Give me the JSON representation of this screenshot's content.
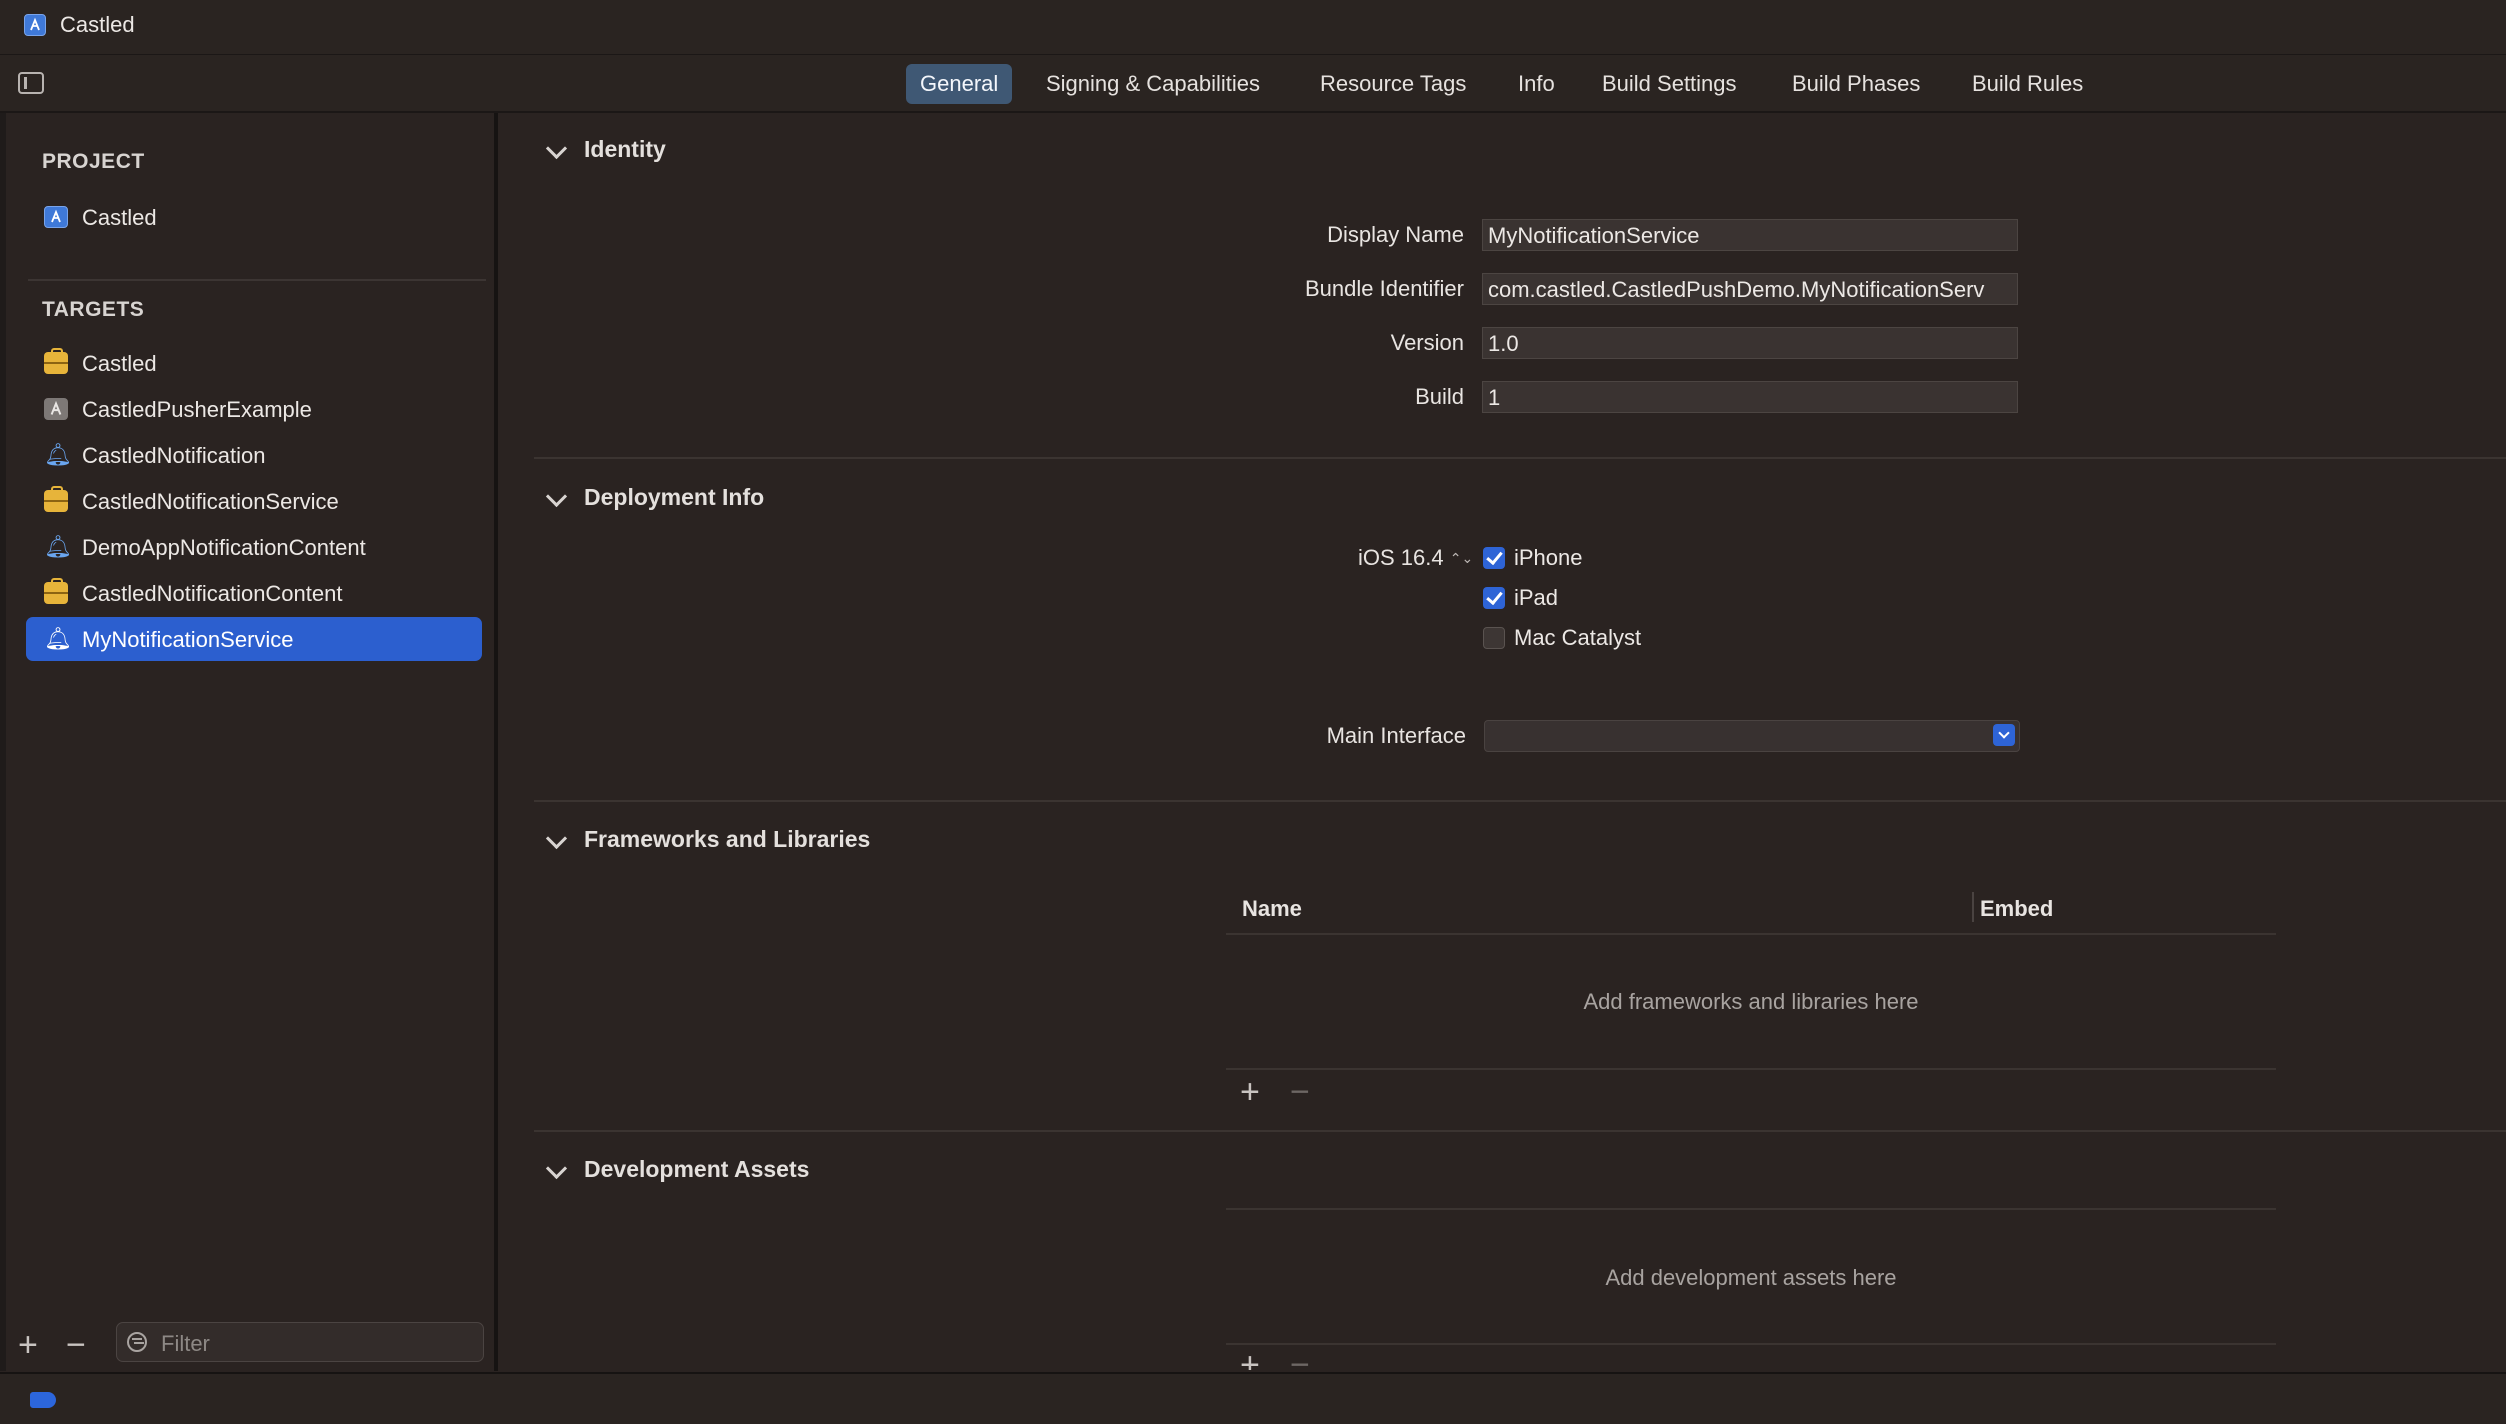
{
  "window": {
    "title": "Castled"
  },
  "tabs": [
    {
      "label": "General",
      "active": true
    },
    {
      "label": "Signing & Capabilities"
    },
    {
      "label": "Resource Tags"
    },
    {
      "label": "Info"
    },
    {
      "label": "Build Settings"
    },
    {
      "label": "Build Phases"
    },
    {
      "label": "Build Rules"
    }
  ],
  "sidebar": {
    "project_heading": "PROJECT",
    "project_item": "Castled",
    "targets_heading": "TARGETS",
    "targets": [
      {
        "label": "Castled",
        "icon": "briefcase-icon"
      },
      {
        "label": "CastledPusherExample",
        "icon": "app-icon"
      },
      {
        "label": "CastledNotification",
        "icon": "bell-icon"
      },
      {
        "label": "CastledNotificationService",
        "icon": "briefcase-icon"
      },
      {
        "label": "DemoAppNotificationContent",
        "icon": "bell-icon"
      },
      {
        "label": "CastledNotificationContent",
        "icon": "briefcase-icon"
      },
      {
        "label": "MyNotificationService",
        "icon": "bell-icon",
        "selected": true
      }
    ],
    "filter_placeholder": "Filter"
  },
  "identity": {
    "title": "Identity",
    "display_name_label": "Display Name",
    "display_name_value": "MyNotificationService",
    "bundle_identifier_label": "Bundle Identifier",
    "bundle_identifier_value": "com.castled.CastledPushDemo.MyNotificationServ",
    "version_label": "Version",
    "version_value": "1.0",
    "build_label": "Build",
    "build_value": "1"
  },
  "deployment": {
    "title": "Deployment Info",
    "ios_version": "iOS 16.4",
    "iphone_label": "iPhone",
    "iphone_checked": true,
    "ipad_label": "iPad",
    "ipad_checked": true,
    "mac_catalyst_label": "Mac Catalyst",
    "mac_catalyst_checked": false,
    "main_interface_label": "Main Interface",
    "main_interface_value": ""
  },
  "frameworks": {
    "title": "Frameworks and Libraries",
    "col_name": "Name",
    "col_embed": "Embed",
    "empty_text": "Add frameworks and libraries here"
  },
  "dev_assets": {
    "title": "Development Assets",
    "empty_text": "Add development assets here"
  },
  "colors": {
    "accent": "#2c5fcf",
    "background": "#2a2321",
    "tab_active": "#3f5874"
  }
}
